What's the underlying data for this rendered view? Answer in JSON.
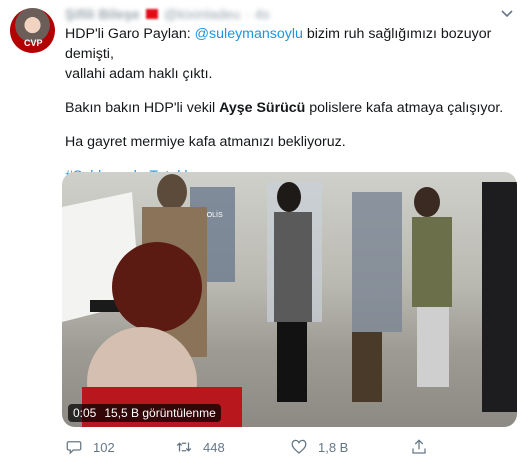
{
  "author": {
    "name": "Şifili Bileşe",
    "handle": "@kixinladeu",
    "time": "· 4s"
  },
  "tweet": {
    "line1_prefix": "HDP'li Garo Paylan: ",
    "line1_mention": "@suleymansoylu",
    "line1_suffix": "  bizim ruh sağlığımızı bozuyor demişti,",
    "line2": "vallahi adam haklı çıktı.",
    "line3_prefix": "Bakın bakın HDP'li vekil ",
    "line3_bold": "Ayşe Sürücü",
    "line3_suffix": " polislere kafa atmaya çalışıyor.",
    "line4": "Ha gayret mermiye kafa atmanızı bekliyoruz.",
    "hashtag": "#SaldırganlarTutuklansın"
  },
  "video": {
    "duration": "0:05",
    "views": "15,5 B görüntülenme",
    "shield_label": "POLİS"
  },
  "actions": {
    "reply_count": "102",
    "retweet_count": "448",
    "like_count": "1,8 B"
  },
  "icons": [
    "chevron-down-icon",
    "reply-icon",
    "retweet-icon",
    "like-icon",
    "share-icon"
  ]
}
